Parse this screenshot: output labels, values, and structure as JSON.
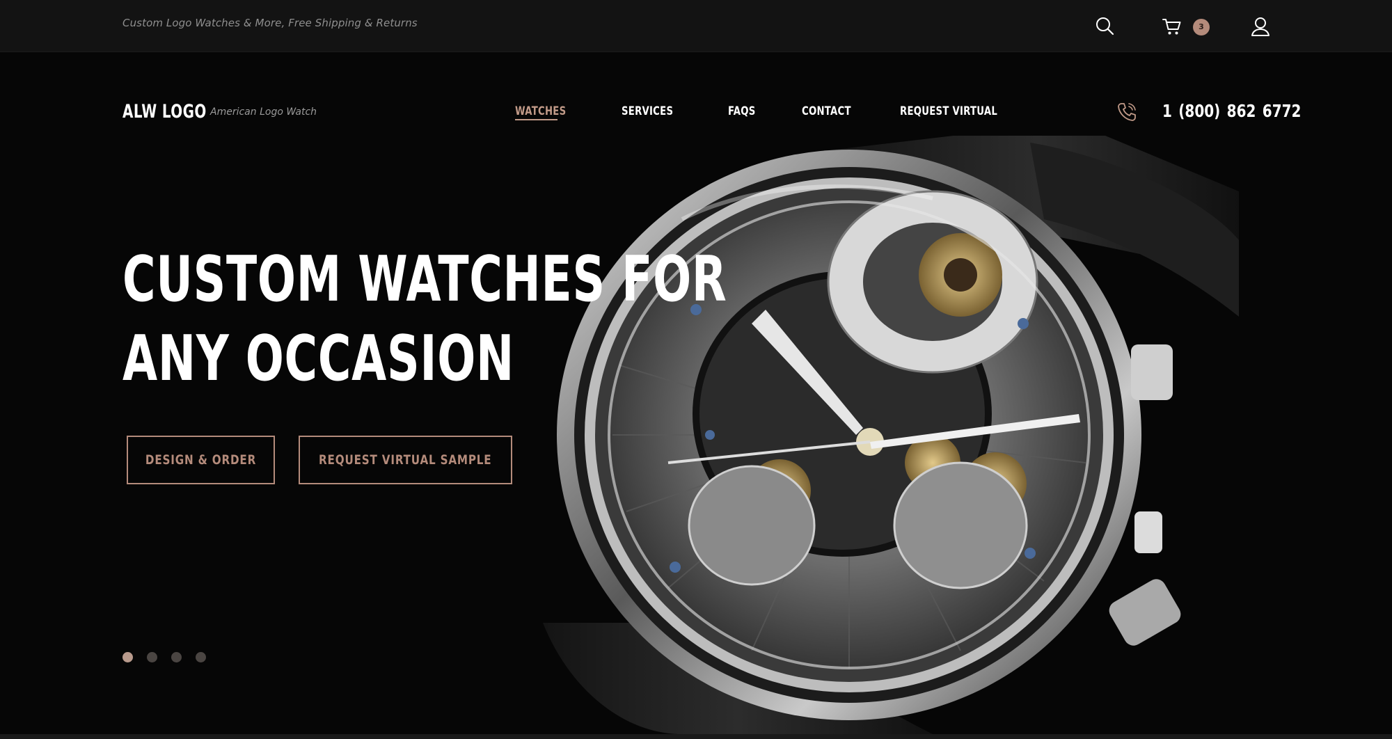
{
  "topbar": {
    "promo": "Custom Logo Watches & More, Free Shipping & Returns",
    "icons": [
      "search-icon",
      "cart-icon",
      "user-icon"
    ],
    "cart_count": "3"
  },
  "header": {
    "logo": "ALW LOGO",
    "tagline": "American Logo Watch",
    "nav": [
      {
        "label": "WATCHES",
        "active": true
      },
      {
        "label": "SERVICES"
      },
      {
        "label": "FAQS"
      },
      {
        "label": "CONTACT"
      },
      {
        "label": "REQUEST VIRTUAL"
      }
    ],
    "phone": "1 (800) 862  6772",
    "phone_icon": "phone-icon"
  },
  "hero": {
    "headline_line1": "CUSTOM WATCHES FOR",
    "headline_line2": "ANY OCCASION",
    "buttons": {
      "design": "DESIGN & ORDER",
      "sample": "REQUEST VIRTUAL SAMPLE"
    },
    "slides_total": 4,
    "slide_active": 1
  },
  "colors": {
    "accent": "#b48b7b",
    "background": "#070707",
    "topbar": "#131313"
  }
}
